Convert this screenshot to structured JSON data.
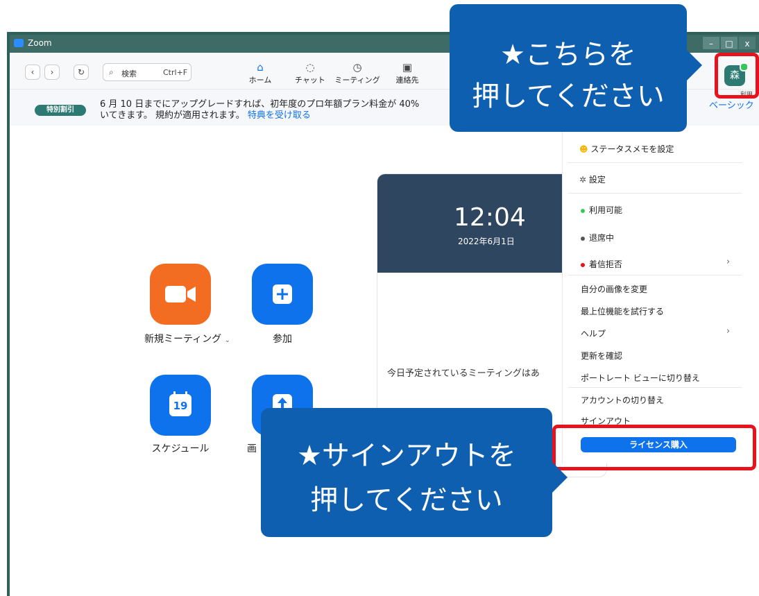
{
  "window": {
    "title": "Zoom",
    "controls": [
      "–",
      "□",
      "x"
    ]
  },
  "toolbar": {
    "back": "‹",
    "forward": "›",
    "history": "↻",
    "search_placeholder": "検索",
    "search_shortcut": "Ctrl+F",
    "tabs": [
      {
        "label": "ホーム",
        "icon": "home-icon"
      },
      {
        "label": "チャット",
        "icon": "chat-icon"
      },
      {
        "label": "ミーティング",
        "icon": "clock-icon"
      },
      {
        "label": "連絡先",
        "icon": "contacts-icon"
      }
    ]
  },
  "banner": {
    "badge": "特別割引",
    "line1": "6 月 10 日までにアップグレードすれば、初年度のプロ年額プラン料金が 40%",
    "line2": "いてきます。 規約が適用されます。",
    "link": "特典を受け取る",
    "right": "ベーシック"
  },
  "actions": [
    {
      "label": "新規ミーティング",
      "suffix": "⌄",
      "color": "#f26d21",
      "icon": "video-camera-icon"
    },
    {
      "label": "参加",
      "suffix": "",
      "color": "#0e72ed",
      "icon": "plus-icon"
    },
    {
      "label": "スケジュール",
      "suffix": "",
      "color": "#0e72ed",
      "icon": "calendar-icon",
      "icon_text": "19"
    },
    {
      "label": "画",
      "suffix": "",
      "color": "#0e72ed",
      "icon": "share-screen-icon"
    }
  ],
  "clock": {
    "time": "12:04",
    "date": "2022年6月1日",
    "no_meetings": "今日予定されているミーティングはあ"
  },
  "menu": {
    "status_memo": "ステータスメモを設定",
    "settings": "設定",
    "available": "利用可能",
    "away": "退席中",
    "dnd": "着信拒否",
    "change_picture": "自分の画像を変更",
    "try_top": "最上位機能を試行する",
    "help": "ヘルプ",
    "check_updates": "更新を確認",
    "portrait_view": "ポートレート ビューに切り替え",
    "switch_account": "アカウントの切り替え",
    "sign_out": "サインアウト",
    "buy_license": "ライセンス購入"
  },
  "avatar": {
    "initial": "森",
    "tooltip": "利用"
  },
  "callouts": {
    "top_line1": "★こちらを",
    "top_line2": "押してください",
    "bottom_line1": "★サインアウトを",
    "bottom_line2": "押してください"
  },
  "colors": {
    "accent": "#0e72ed",
    "callout": "#0f5fb0",
    "highlight": "#e8121c",
    "titlebar": "#3f6b66"
  }
}
